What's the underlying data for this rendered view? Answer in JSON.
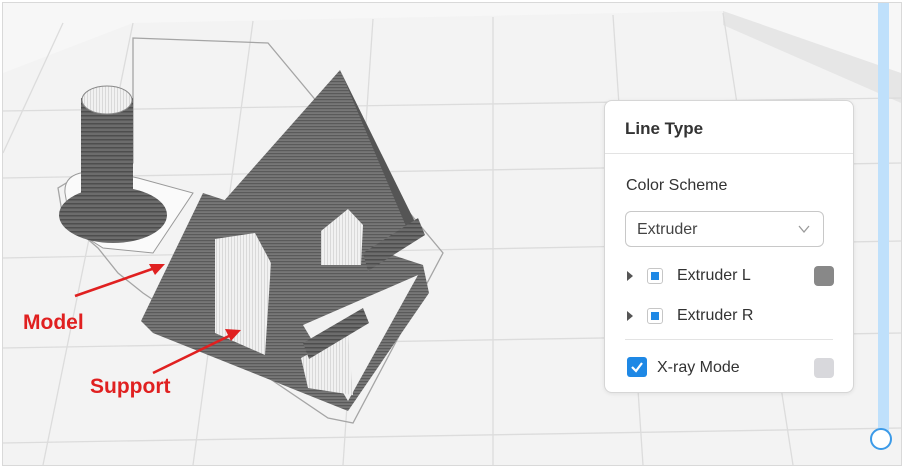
{
  "annotations": {
    "model_label": "Model",
    "support_label": "Support"
  },
  "panel": {
    "title": "Line Type",
    "color_scheme_label": "Color Scheme",
    "color_scheme_value": "Extruder",
    "extruders": [
      {
        "label": "Extruder L",
        "visible": true,
        "color": "#888888"
      },
      {
        "label": "Extruder R",
        "visible": true
      }
    ],
    "xray": {
      "label": "X-ray Mode",
      "checked": true,
      "swatch_color": "#d8d8dc"
    }
  },
  "layer_slider": {
    "position": 1.0
  },
  "colors": {
    "accent": "#1e88e5",
    "annotation": "#e02020",
    "slider_track": "#bfe0fb"
  }
}
